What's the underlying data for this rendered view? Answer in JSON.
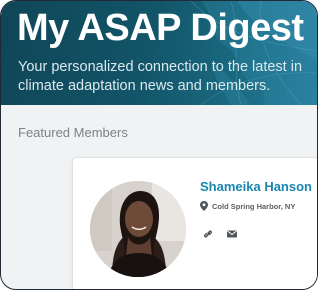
{
  "hero": {
    "title": "My ASAP Digest",
    "subtitle": "Your personalized connection to the latest in climate adaptation news and members."
  },
  "featured": {
    "heading": "Featured Members",
    "member": {
      "name": "Shameika Hanson",
      "location": "Cold Spring Harbor, NY",
      "icons": [
        "map-pin-icon",
        "link-icon",
        "email-icon"
      ]
    }
  },
  "colors": {
    "hero_bg": "#125468",
    "name_link": "#1a86b0",
    "page_bg": "#f1f2f3"
  }
}
